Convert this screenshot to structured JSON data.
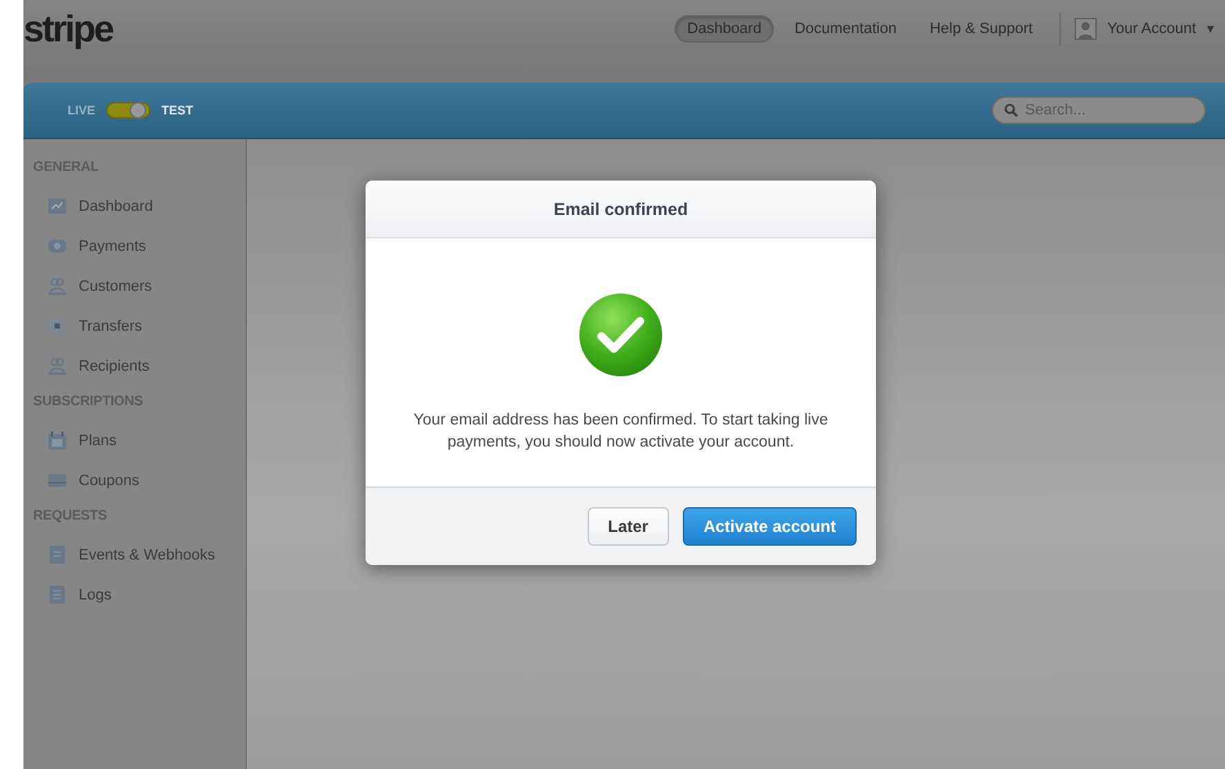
{
  "header": {
    "logo": "stripe",
    "nav": [
      {
        "label": "Dashboard",
        "selected": true
      },
      {
        "label": "Documentation",
        "selected": false
      },
      {
        "label": "Help & Support",
        "selected": false
      }
    ],
    "account": "Your Account",
    "account_caret": "▾"
  },
  "toolbar": {
    "live_label": "LIVE",
    "test_label": "TEST",
    "test_mode": true,
    "search": {
      "placeholder": "Search..."
    }
  },
  "sidebar": {
    "sections": [
      {
        "heading": "GENERAL",
        "items": [
          "Dashboard",
          "Payments",
          "Customers",
          "Transfers",
          "Recipients"
        ]
      },
      {
        "heading": "SUBSCRIPTIONS",
        "items": [
          "Plans",
          "Coupons"
        ]
      },
      {
        "heading": "REQUESTS",
        "items": [
          "Events & Webhooks",
          "Logs"
        ]
      }
    ]
  },
  "dialog": {
    "title": "Email confirmed",
    "message": "Your email address has been confirmed. To start taking live payments, you should now activate your account.",
    "buttons": [
      {
        "label": "Later",
        "kind": "secondary"
      },
      {
        "label": "Activate account",
        "kind": "primary"
      }
    ]
  }
}
